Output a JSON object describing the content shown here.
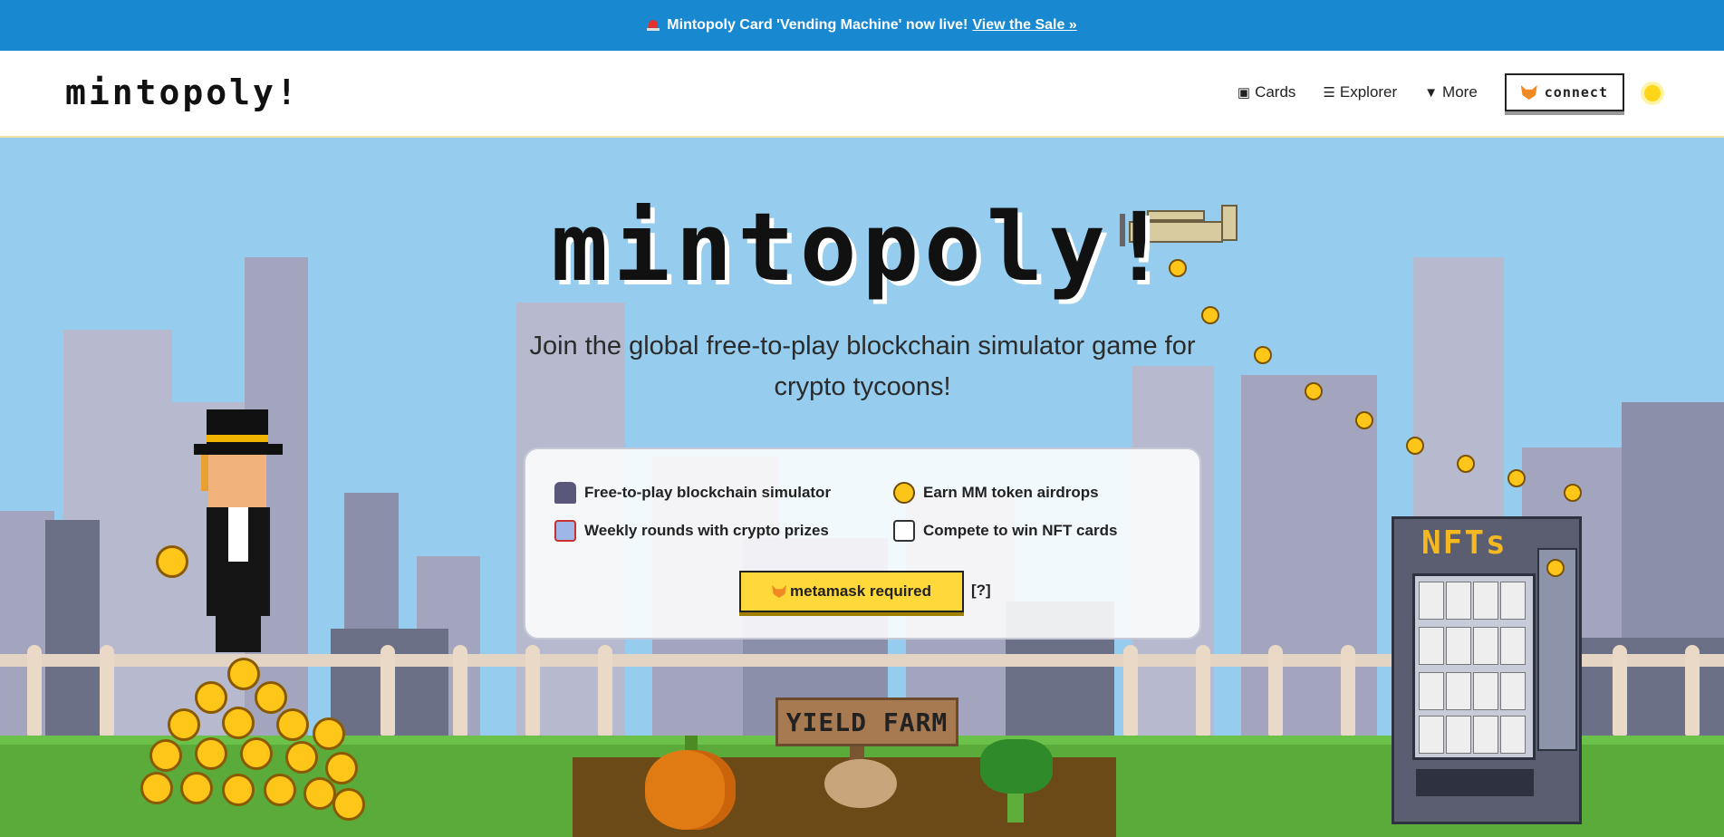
{
  "promo": {
    "text": "Mintopoly Card 'Vending Machine' now live!",
    "link": "View the Sale »"
  },
  "nav": {
    "logo": "mintopoly!",
    "items": [
      {
        "label": "Cards",
        "icon": "card-icon"
      },
      {
        "label": "Explorer",
        "icon": "list-icon"
      },
      {
        "label": "More",
        "icon": "triangle-down-icon"
      }
    ],
    "connect": "connect"
  },
  "hero": {
    "title": "mintopoly!",
    "tagline": "Join the global free-to-play blockchain simulator game for crypto tycoons!",
    "features": [
      {
        "label": "Free-to-play blockchain simulator",
        "icon": "joystick-icon"
      },
      {
        "label": "Earn MM token airdrops",
        "icon": "mm-coin-icon"
      },
      {
        "label": "Weekly rounds with crypto prizes",
        "icon": "gift-icon"
      },
      {
        "label": "Compete to win NFT cards",
        "icon": "nft-card-icon"
      }
    ],
    "cta": "metamask required",
    "help": "[?]"
  },
  "scene": {
    "sign": "YIELD FARM",
    "vending_title": "NFTs"
  },
  "colors": {
    "promo_bg": "#1888d0",
    "sky": "#96cdee",
    "cta": "#ffd83a",
    "grass": "#5bab3b"
  }
}
